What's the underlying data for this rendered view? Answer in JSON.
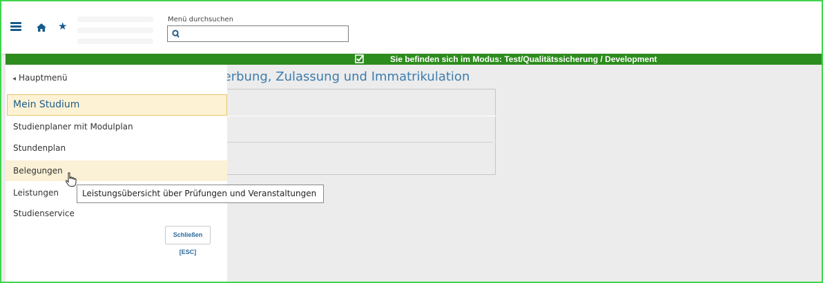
{
  "header": {
    "search": {
      "label": "Menü durchsuchen",
      "value": "",
      "placeholder": ""
    },
    "icons": [
      "hamburger-icon",
      "home-icon",
      "star-icon",
      "search-icon"
    ]
  },
  "modebar": {
    "text": "Sie befinden sich im Modus: Test/Qualitätssicherung / Development",
    "color": "#2d8c1e"
  },
  "main": {
    "title_fragment": "verbung, Zulassung und Immatrikulation"
  },
  "menu": {
    "back_label": "Hauptmenü",
    "active_item": "Mein Studium",
    "items": [
      {
        "label": "Studienplaner mit Modulplan"
      },
      {
        "label": "Stundenplan"
      },
      {
        "label": "Belegungen"
      },
      {
        "label": "Leistungen"
      },
      {
        "label": "Studienservice"
      }
    ],
    "close_label": "Schließen [ESC]"
  },
  "tooltip": {
    "text": "Leistungsübersicht über Prüfungen und Veranstaltungen"
  },
  "colors": {
    "accent": "#1d5c8c",
    "title": "#3c7cad",
    "highlight": "#fdf2d4",
    "frame": "#3fd54a"
  }
}
